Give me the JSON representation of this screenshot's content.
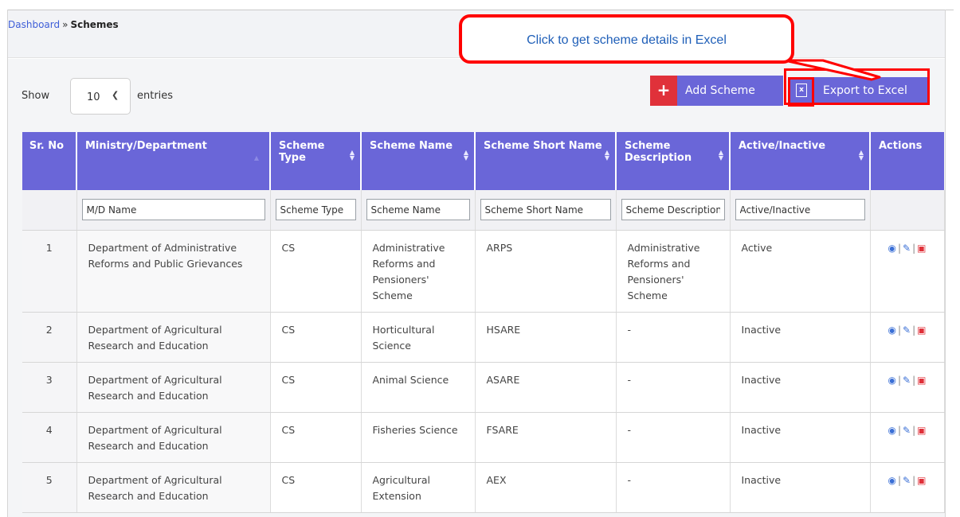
{
  "breadcrumb": {
    "parent": "Dashboard",
    "separator": "»",
    "current": "Schemes"
  },
  "length_control": {
    "show_label": "Show",
    "selected": "10",
    "entries_label": "entries"
  },
  "buttons": {
    "add_label": "Add Scheme",
    "add_icon": "plus-icon",
    "export_label": "Export to Excel",
    "export_icon": "excel-file-icon"
  },
  "callout": {
    "text": "Click to get scheme details in Excel"
  },
  "table": {
    "columns": [
      "Sr. No",
      "Ministry/Department",
      "Scheme Type",
      "Scheme Name",
      "Scheme Short Name",
      "Scheme Description",
      "Active/Inactive",
      "Actions"
    ],
    "filters": [
      "M/D Name",
      "Scheme Type",
      "Scheme Name",
      "Scheme Short Name",
      "Scheme Description",
      "Active/Inactive"
    ],
    "rows": [
      {
        "sr": "1",
        "ministry": "Department of Administrative Reforms and Public Grievances",
        "type": "CS",
        "name": "Administrative Reforms and Pensioners' Scheme",
        "short": "ARPS",
        "description": "Administrative Reforms and Pensioners' Scheme",
        "status": "Active"
      },
      {
        "sr": "2",
        "ministry": "Department of Agricultural Research and Education",
        "type": "CS",
        "name": "Horticultural Science",
        "short": "HSARE",
        "description": "-",
        "status": "Inactive"
      },
      {
        "sr": "3",
        "ministry": "Department of Agricultural Research and Education",
        "type": "CS",
        "name": "Animal Science",
        "short": "ASARE",
        "description": "-",
        "status": "Inactive"
      },
      {
        "sr": "4",
        "ministry": "Department of Agricultural Research and Education",
        "type": "CS",
        "name": "Fisheries Science",
        "short": "FSARE",
        "description": "-",
        "status": "Inactive"
      },
      {
        "sr": "5",
        "ministry": "Department of Agricultural Research and Education",
        "type": "CS",
        "name": "Agricultural Extension",
        "short": "AEX",
        "description": "-",
        "status": "Inactive"
      }
    ],
    "action_icons": [
      "eye-icon",
      "edit-icon",
      "trash-icon"
    ]
  },
  "colors": {
    "header": "#6a66d8",
    "add_accent": "#e0313a",
    "highlight": "#ff0000",
    "callout_text": "#1f5fb8",
    "link": "#3e5ed8"
  }
}
